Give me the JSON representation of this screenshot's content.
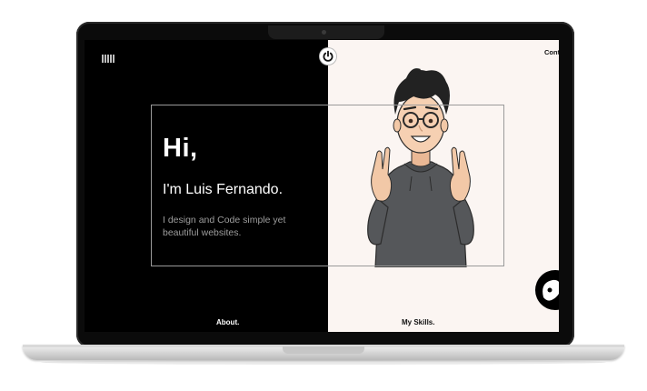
{
  "hero": {
    "greeting": "Hi,",
    "name_line": "I'm Luis Fernando.",
    "tagline": "I design and Code simple yet beautiful websites."
  },
  "nav": {
    "menu_icon": "menu-bars-icon",
    "power_icon": "power-icon",
    "contact_label": "Cont",
    "about_label": "About.",
    "skills_label": "My Skills."
  },
  "chat": {
    "icon": "chat-ghost-icon"
  },
  "colors": {
    "left_bg": "#000000",
    "right_bg": "#fbf5f2",
    "tagline": "#9d9d9d",
    "frame_line": "#9a9a9a"
  }
}
